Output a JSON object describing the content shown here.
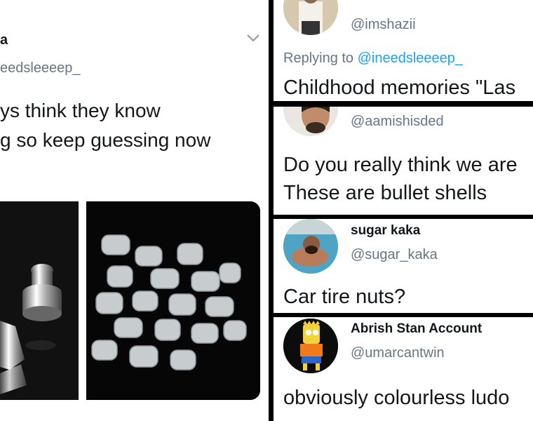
{
  "original_tweet": {
    "name_fragment": "a",
    "handle_fragment": "eedsleeeep_",
    "text_line1": "ys think they know",
    "text_line2": "g so keep guessing now",
    "media": [
      "metal-earring-backs-photo",
      "plastic-earring-backs-photo"
    ]
  },
  "replies": [
    {
      "handle": "@imshazii",
      "replying_prefix": "Replying to",
      "replying_to": "@ineedsleeeep_",
      "text": "Childhood memories \"Las"
    },
    {
      "handle": "@aamishisded",
      "text_line1": "Do you really think we are",
      "text_line2": "These are bullet shells"
    },
    {
      "name": "sugar kaka",
      "handle": "@sugar_kaka",
      "text": "Car tire nuts?"
    },
    {
      "name": "Abrish Stan Account",
      "handle": "@umarcantwin",
      "text": "obviously colourless ludo"
    }
  ],
  "icons": {
    "caret": "chevron-down-icon"
  },
  "colors": {
    "link": "#1da1f2",
    "handle": "#657786",
    "text": "#14171a",
    "divider": "#000000"
  }
}
